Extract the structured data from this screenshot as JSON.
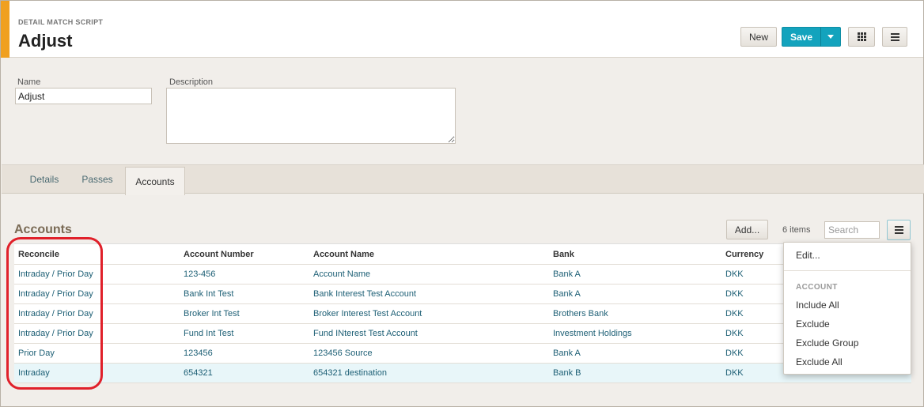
{
  "header": {
    "eyebrow": "DETAIL MATCH SCRIPT",
    "title": "Adjust",
    "new_label": "New",
    "save_label": "Save"
  },
  "form": {
    "name_label": "Name",
    "name_value": "Adjust",
    "description_label": "Description",
    "description_value": ""
  },
  "tabs": [
    {
      "label": "Details"
    },
    {
      "label": "Passes"
    },
    {
      "label": "Accounts",
      "active": true
    }
  ],
  "accounts": {
    "title": "Accounts",
    "add_label": "Add...",
    "items_count": "6 items",
    "search_placeholder": "Search",
    "columns": [
      "Reconcile",
      "Account Number",
      "Account Name",
      "Bank",
      "Currency"
    ],
    "rows": [
      {
        "reconcile": "Intraday / Prior Day",
        "number": "123-456",
        "name": "Account Name",
        "bank": "Bank A",
        "currency": "DKK"
      },
      {
        "reconcile": "Intraday / Prior Day",
        "number": "Bank Int Test",
        "name": "Bank Interest Test Account",
        "bank": "Bank A",
        "currency": "DKK"
      },
      {
        "reconcile": "Intraday / Prior Day",
        "number": "Broker Int Test",
        "name": "Broker Interest Test Account",
        "bank": "Brothers Bank",
        "currency": "DKK"
      },
      {
        "reconcile": "Intraday / Prior Day",
        "number": "Fund Int Test",
        "name": "Fund INterest Test Account",
        "bank": "Investment Holdings",
        "currency": "DKK"
      },
      {
        "reconcile": "Prior Day",
        "number": "123456",
        "name": "123456 Source",
        "bank": "Bank A",
        "currency": "DKK"
      },
      {
        "reconcile": "Intraday",
        "number": "654321",
        "name": "654321 destination",
        "bank": "Bank B",
        "currency": "DKK"
      }
    ]
  },
  "menu": {
    "edit": "Edit...",
    "section": "ACCOUNT",
    "items": [
      "Include All",
      "Exclude",
      "Exclude Group",
      "Exclude All"
    ]
  },
  "colors": {
    "accent": "#f0a020",
    "primary": "#13a3bd",
    "link": "#1d5f75",
    "annotation": "#e0202a"
  }
}
